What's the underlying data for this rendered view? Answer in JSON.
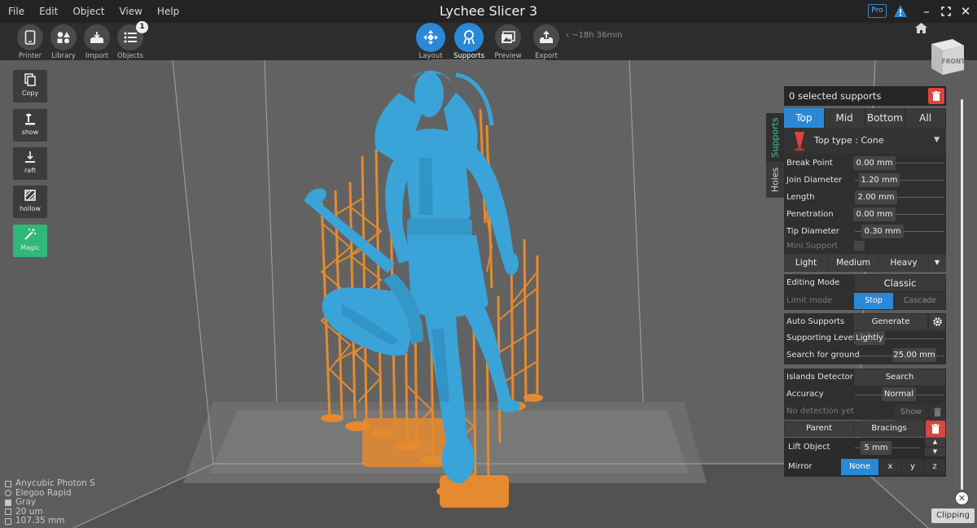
{
  "menu": [
    "File",
    "Edit",
    "Object",
    "View",
    "Help"
  ],
  "app_title": "Lychee Slicer 3",
  "pro_badge": "Pro",
  "toolbar": {
    "left": [
      {
        "label": "Printer",
        "icon": "phone-printer-icon"
      },
      {
        "label": "Library",
        "icon": "shapes-library-icon"
      },
      {
        "label": "Import",
        "icon": "import-tray-icon"
      },
      {
        "label": "Objects",
        "icon": "list-icon",
        "badge": "1"
      }
    ],
    "workflow": [
      {
        "label": "Layout",
        "icon": "move-arrows-icon"
      },
      {
        "label": "Supports",
        "icon": "support-tree-icon",
        "active": true
      },
      {
        "label": "Preview",
        "icon": "images-icon"
      },
      {
        "label": "Export",
        "icon": "export-icon"
      }
    ],
    "time_estimate": "~18h 36min"
  },
  "side_tools": [
    {
      "label": "Copy",
      "icon": "copy-icon"
    },
    {
      "label": "show",
      "icon": "support-show-icon"
    },
    {
      "label": "raft",
      "icon": "raft-download-icon"
    },
    {
      "label": "hollow",
      "icon": "hollow-hatch-icon"
    },
    {
      "label": "Magic",
      "icon": "magic-wand-icon"
    }
  ],
  "view_cube_face": "FRONT",
  "printer_info": [
    "Anycubic Photon S",
    "Elegoo Rapid",
    "Gray",
    "20 um",
    "107.35 mm"
  ],
  "panel": {
    "selected_supports": "0 selected supports",
    "side_tabs": [
      "Supports",
      "Holes"
    ],
    "tabs": [
      "Top",
      "Mid",
      "Bottom",
      "All"
    ],
    "top_type": "Top type : Cone",
    "params": [
      {
        "label": "Break Point",
        "value": "0.00 mm"
      },
      {
        "label": "Join Diameter",
        "value": "1.20 mm"
      },
      {
        "label": "Length",
        "value": "2.00 mm"
      },
      {
        "label": "Penetration",
        "value": "0.00 mm"
      },
      {
        "label": "Tip Diameter",
        "value": "0.30 mm"
      }
    ],
    "mini_support": "Mini Support",
    "presets": [
      "Light",
      "Medium",
      "Heavy"
    ],
    "editing_mode": {
      "label": "Editing Mode",
      "value": "Classic"
    },
    "limit_mode": {
      "label": "Limit mode",
      "options": [
        "Stop",
        "Cascade"
      ]
    },
    "auto_supports": {
      "label": "Auto Supports",
      "button": "Generate"
    },
    "supporting_level": {
      "label": "Supporting Level",
      "value": "Lightly"
    },
    "search_ground": {
      "label": "Search for ground",
      "value": "25.00 mm"
    },
    "islands": {
      "label": "Islands Detector",
      "button": "Search"
    },
    "accuracy": {
      "label": "Accuracy",
      "value": "Normal"
    },
    "no_detection": "No detection yet",
    "show": "Show",
    "parent": "Parent",
    "bracings": "Bracings",
    "lift_object": {
      "label": "Lift Object",
      "value": "5 mm"
    },
    "mirror": {
      "label": "Mirror",
      "options": [
        "None",
        "x",
        "y",
        "z"
      ]
    }
  },
  "clipping": "Clipping",
  "colors": {
    "accent": "#2b88d6",
    "model": "#3aa3d8",
    "supports": "#e58a2e",
    "magic": "#2eb87a",
    "danger": "#d9463d"
  }
}
